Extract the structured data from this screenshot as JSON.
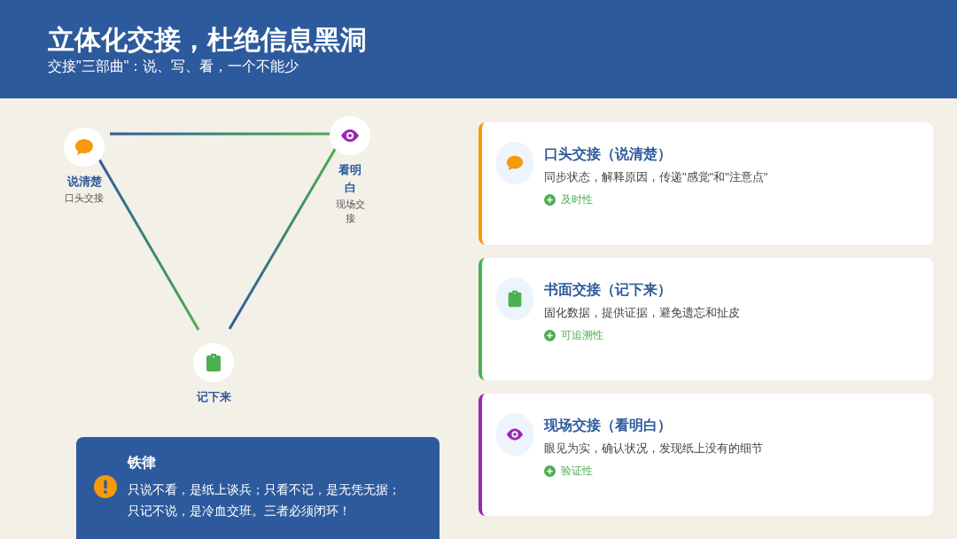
{
  "header": {
    "title": "立体化交接，杜绝信息黑洞",
    "subtitle": "交接\"三部曲\"：说、写、看，一个不能少"
  },
  "diagram": {
    "nodes": [
      {
        "kind": "chat",
        "title": "说清楚",
        "caption": "口头交接"
      },
      {
        "kind": "eye",
        "title": "看明白",
        "caption": "现场交接"
      },
      {
        "kind": "clipboard",
        "title": "记下来"
      }
    ]
  },
  "cards": [
    {
      "kind": "chat",
      "color": "#f59a0c",
      "title": "口头交接（说清楚）",
      "text": "同步状态，解释原因，传递\"感觉\"和\"注意点\"",
      "tag": "及时性"
    },
    {
      "kind": "clipboard",
      "color": "#4caf50",
      "title": "书面交接（记下来）",
      "text": "固化数据，提供证据，避免遗忘和扯皮",
      "tag": "可追溯性"
    },
    {
      "kind": "eye",
      "color": "#9c27b0",
      "title": "现场交接（看明白）",
      "text": "眼见为实，确认状况，发现纸上没有的细节",
      "tag": "验证性"
    }
  ],
  "rule": {
    "title": "铁律",
    "lines": [
      "只说不看，是纸上谈兵；只看不记，是无凭无据；",
      "只记不说，是冷血交班。三者必须闭环！"
    ]
  }
}
